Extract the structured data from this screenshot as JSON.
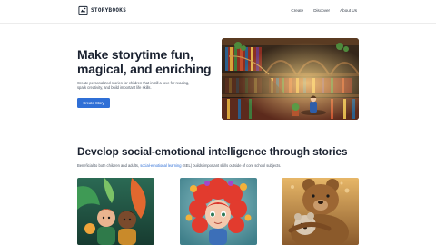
{
  "brand": {
    "name": "STORYBOOKS",
    "logo_icon": "book-sparkle-icon"
  },
  "nav": {
    "links": [
      "Create",
      "Discover",
      "About Us"
    ]
  },
  "hero": {
    "title": "Make storytime fun, magical, and enriching",
    "subtitle": "Create personalized stories for children that instill a love for reading, spark creativity, and build important life skills.",
    "cta_label": "Create Story",
    "image": "magical-library-illustration"
  },
  "section": {
    "title": "Develop social-emotional intelligence through stories",
    "subtitle_before": "Beneficial to both children and adults, ",
    "subtitle_link": "social-emotional learning",
    "subtitle_after": " (SEL) builds important skills outside of core school subjects."
  },
  "cards": [
    {
      "image": "children-with-magical-plants-illustration"
    },
    {
      "image": "red-curly-haired-girl-with-flowers-illustration"
    },
    {
      "image": "bear-hugging-cub-illustration"
    }
  ],
  "colors": {
    "primary": "#2f6fd6",
    "heading": "#1b2230",
    "body_text": "#4b5563"
  }
}
